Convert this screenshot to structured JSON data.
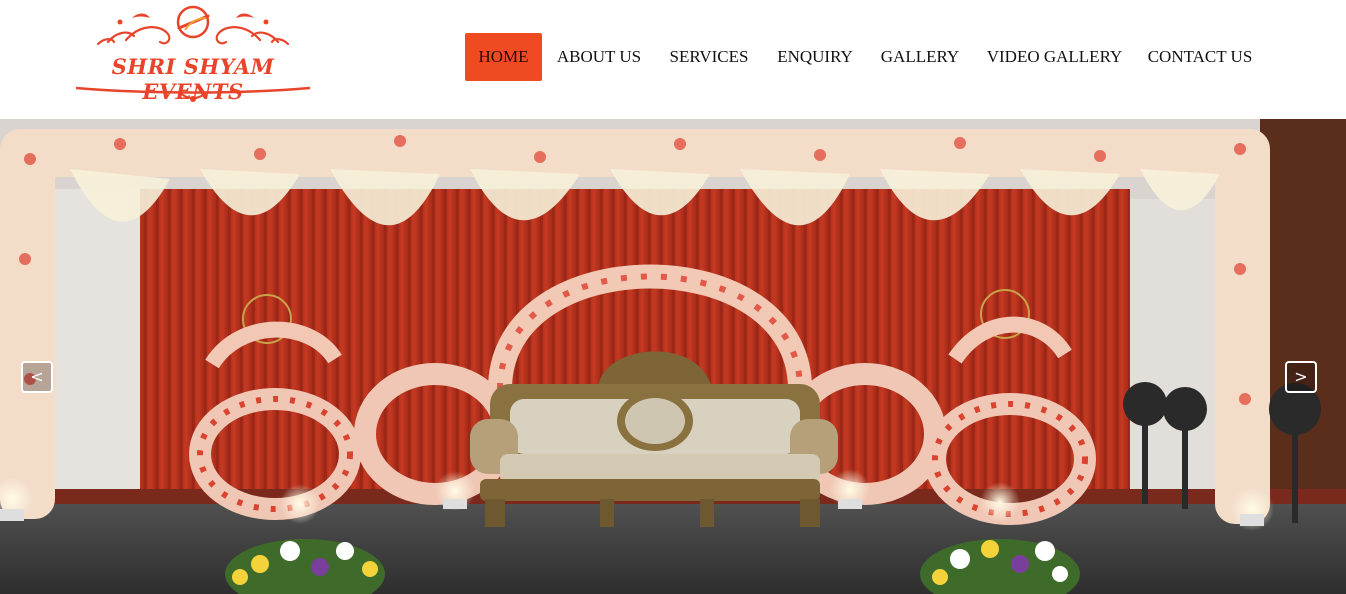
{
  "brand": {
    "logo_text": "SHRI SHYAM EVENTS"
  },
  "nav": {
    "items": [
      "HOME",
      "ABOUT US",
      "SERVICES",
      "ENQUIRY",
      "GALLERY",
      "VIDEO GALLERY",
      "CONTACT US"
    ],
    "active": "HOME"
  },
  "slider": {
    "prev_label": "<",
    "next_label": ">"
  },
  "colors": {
    "accent": "#f04a23",
    "logo_orange": "#e8442a",
    "curtain_red": "#b8321f"
  }
}
